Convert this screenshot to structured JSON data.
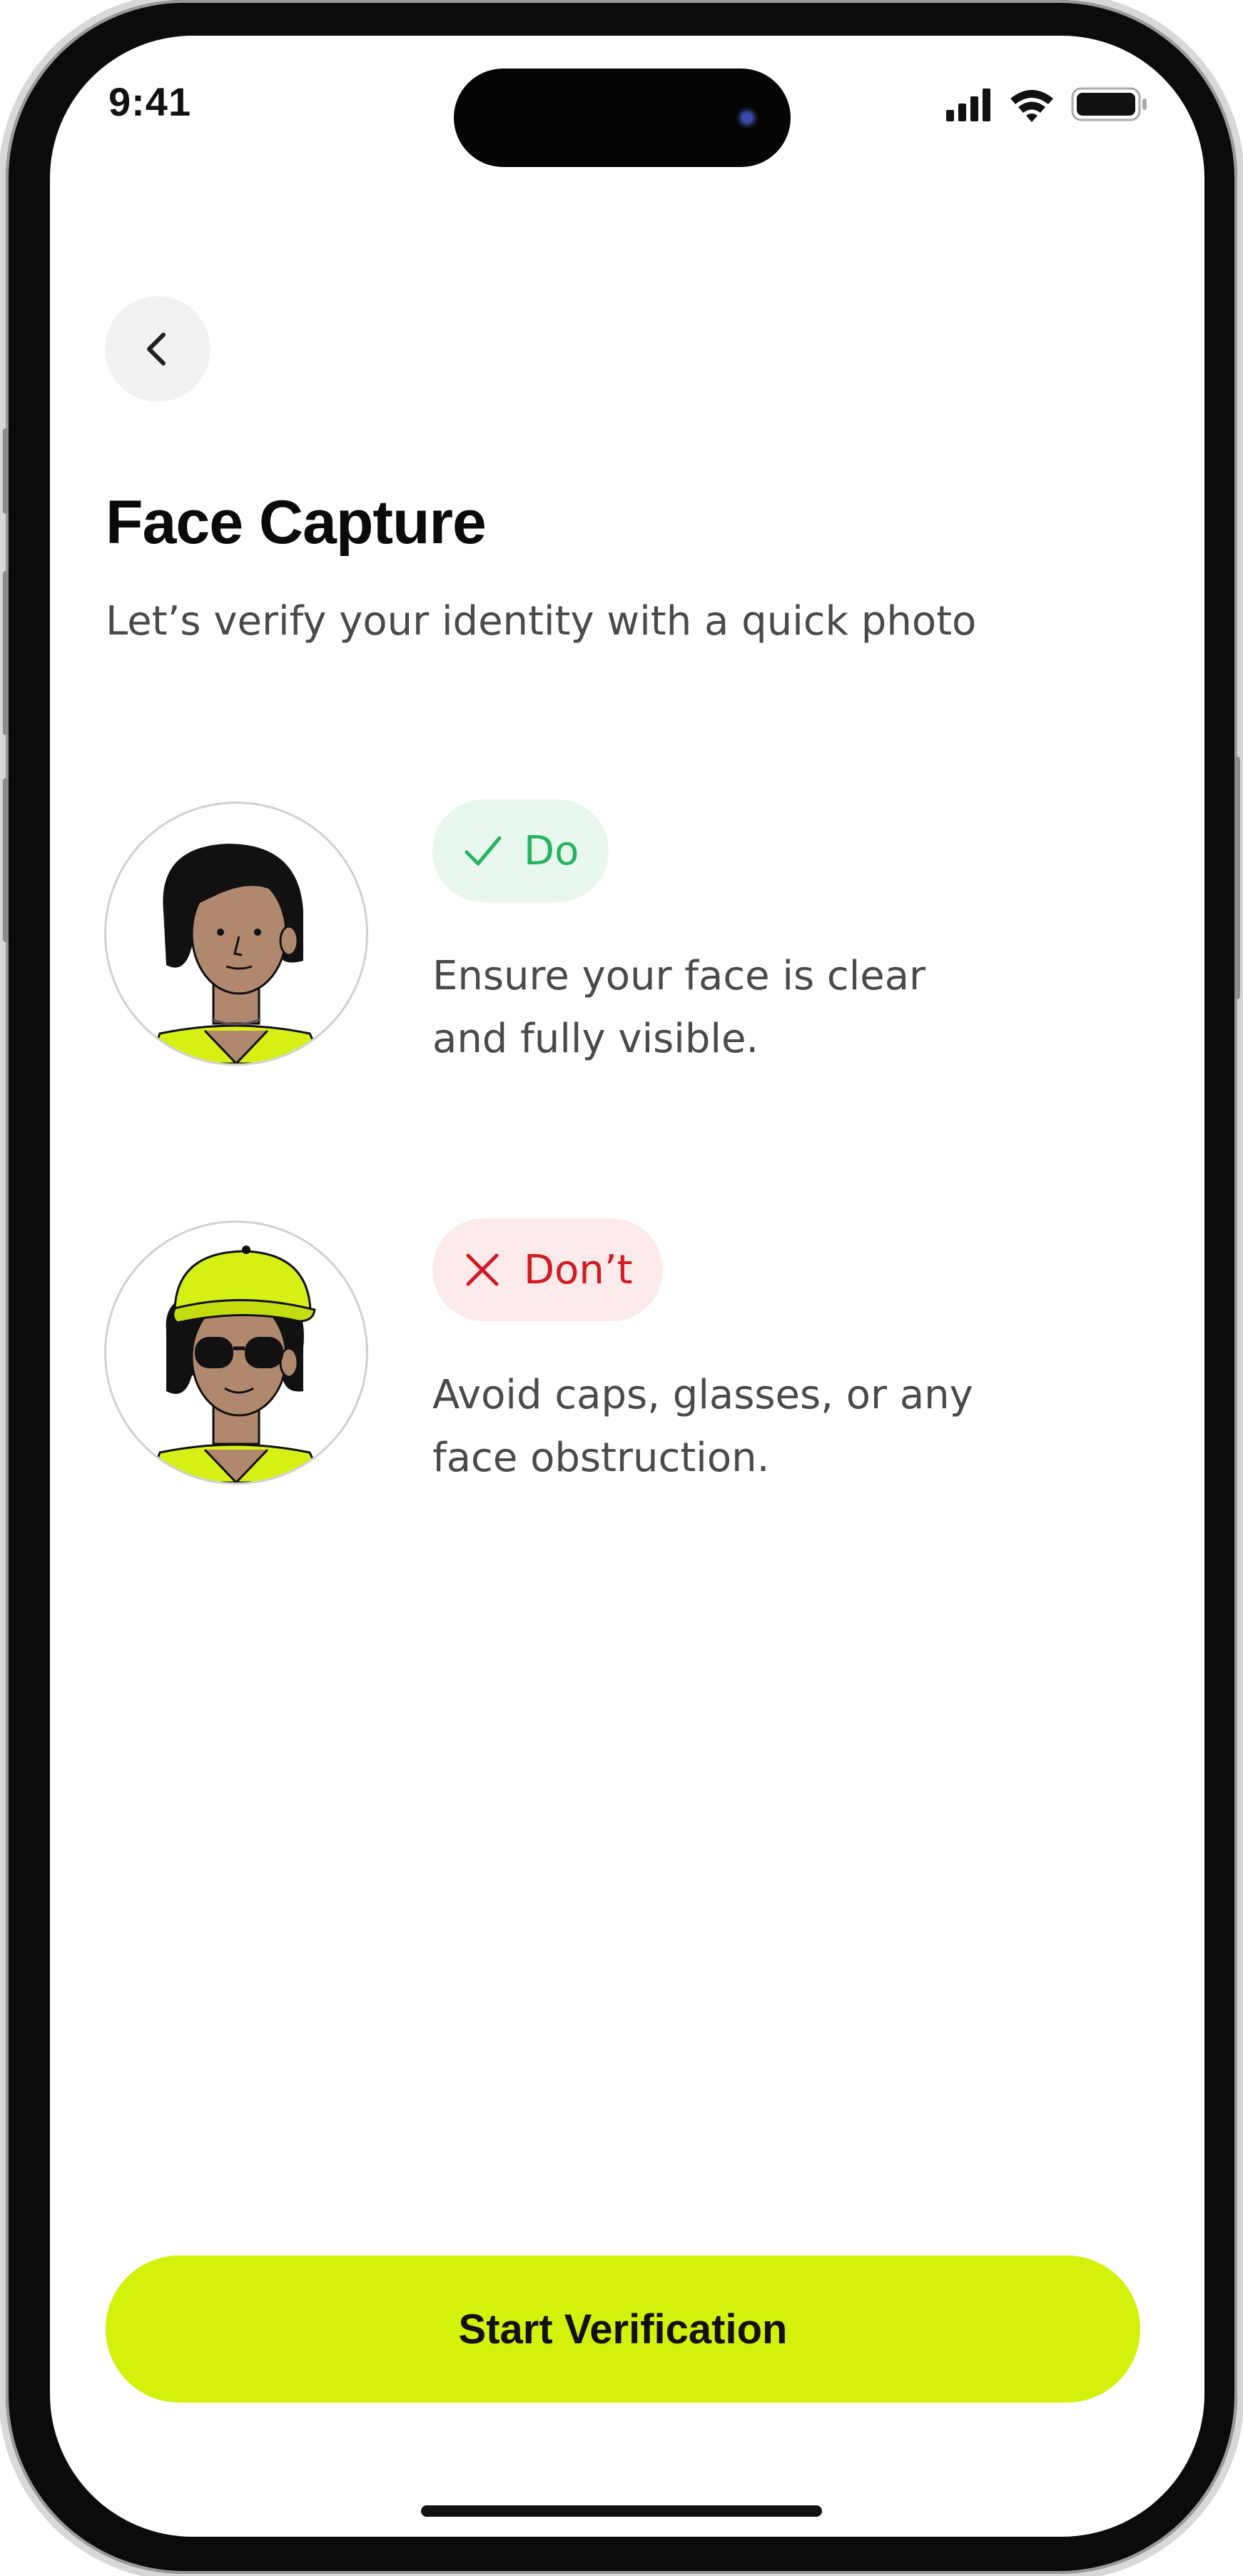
{
  "status_bar": {
    "time": "9:41",
    "signal_icon": "cellular-signal-icon",
    "wifi_icon": "wifi-icon",
    "battery_icon": "battery-icon"
  },
  "header": {
    "back_icon": "chevron-left-icon",
    "title": "Face Capture",
    "subtitle": "Let’s verify your identity with a quick photo"
  },
  "guidelines": [
    {
      "badge_label": "Do",
      "badge_icon": "checkmark-icon",
      "badge_color": "#27b45f",
      "badge_bg": "#e9f8ef",
      "description": "Ensure your face is clear and fully visible."
    },
    {
      "badge_label": "Don’t",
      "badge_icon": "x-mark-icon",
      "badge_color": "#d01b22",
      "badge_bg": "#fdeaea",
      "description": "Avoid caps, glasses, or any face obstruction."
    }
  ],
  "cta": {
    "label": "Start Verification",
    "color": "#d3f10b"
  }
}
